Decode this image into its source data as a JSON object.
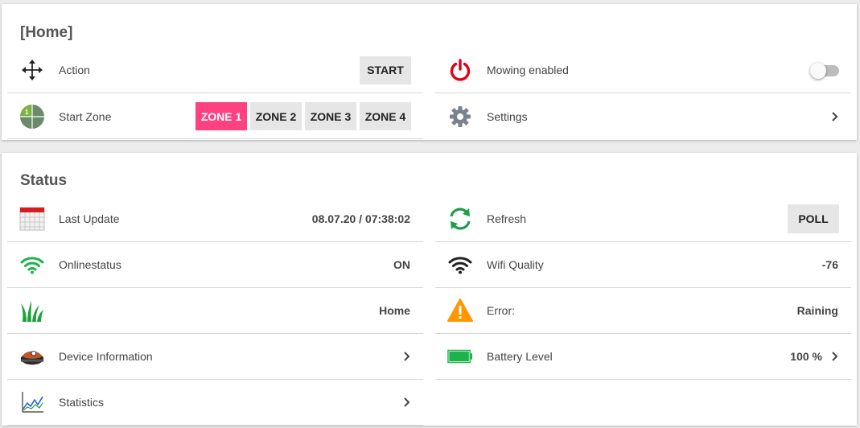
{
  "home": {
    "title": "[Home]",
    "action": {
      "label": "Action",
      "button": "START",
      "icon": "move-arrows-icon"
    },
    "mowing": {
      "label": "Mowing enabled",
      "enabled": false,
      "icon": "power-icon",
      "color": "#e0001a"
    },
    "start_zone": {
      "label": "Start Zone",
      "icon": "zone-pie-icon",
      "zones": [
        "ZONE 1",
        "ZONE 2",
        "ZONE 3",
        "ZONE 4"
      ],
      "active": 0
    },
    "settings": {
      "label": "Settings",
      "icon": "gear-icon"
    }
  },
  "status": {
    "title": "Status",
    "last_update": {
      "label": "Last Update",
      "value": "08.07.20 / 07:38:02",
      "icon": "calendar-icon"
    },
    "refresh": {
      "label": "Refresh",
      "button": "POLL",
      "icon": "refresh-icon"
    },
    "online": {
      "label": "Onlinestatus",
      "value": "ON",
      "icon": "wifi-icon"
    },
    "wifi_quality": {
      "label": "Wifi Quality",
      "value": "-76",
      "icon": "wifi-icon"
    },
    "location": {
      "label": "",
      "value": "Home",
      "icon": "grass-icon"
    },
    "error": {
      "label": "Error:",
      "value": "Raining",
      "icon": "warning-icon"
    },
    "device_info": {
      "label": "Device Information",
      "icon": "mower-icon"
    },
    "battery": {
      "label": "Battery Level",
      "value": "100 %",
      "level": 1.0,
      "icon": "battery-icon"
    },
    "statistics": {
      "label": "Statistics",
      "icon": "chart-icon"
    }
  },
  "colors": {
    "accent": "#ff4081",
    "green": "#1db34a",
    "orange": "#ff9800",
    "red": "#e0001a"
  }
}
